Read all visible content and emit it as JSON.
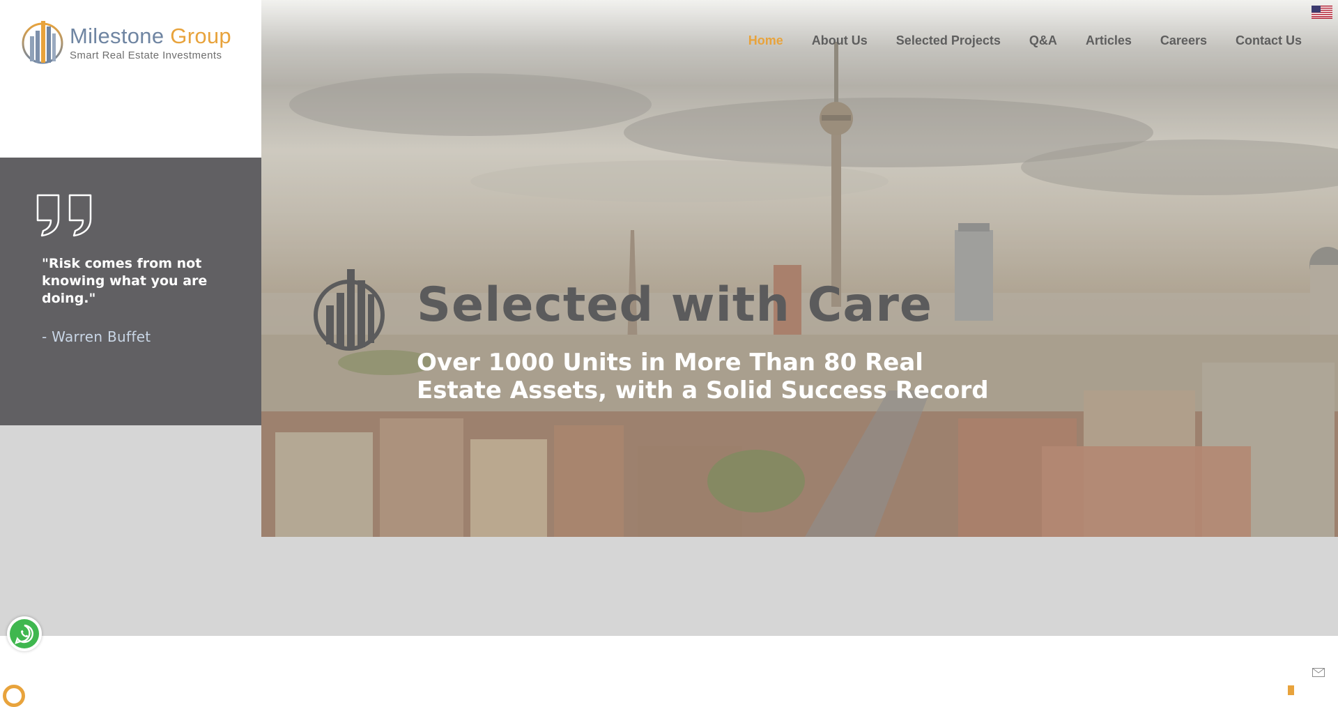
{
  "brand": {
    "name_part1": "Milestone",
    "name_part2": "Group",
    "tagline": "Smart Real Estate Investments",
    "color_primary": "#6f85a2",
    "color_accent": "#e8a33c"
  },
  "nav": {
    "items": [
      {
        "label": "Home",
        "active": true
      },
      {
        "label": "About Us",
        "active": false
      },
      {
        "label": "Selected Projects",
        "active": false
      },
      {
        "label": "Q&A",
        "active": false
      },
      {
        "label": "Articles",
        "active": false
      },
      {
        "label": "Careers",
        "active": false
      },
      {
        "label": "Contact Us",
        "active": false
      }
    ],
    "language_icon": "us-flag-icon"
  },
  "quote": {
    "icon": "quote-icon",
    "text": "\"Risk comes from not knowing what you are doing.\"",
    "author": "- Warren Buffet"
  },
  "hero": {
    "title": "Selected with Care",
    "subtitle": "Over 1000 Units in More Than 80 Real Estate Assets, with a Solid Success Record",
    "icon": "building-bars-icon"
  },
  "floating": {
    "whatsapp_icon": "whatsapp-icon",
    "mail_icon": "mail-icon"
  }
}
